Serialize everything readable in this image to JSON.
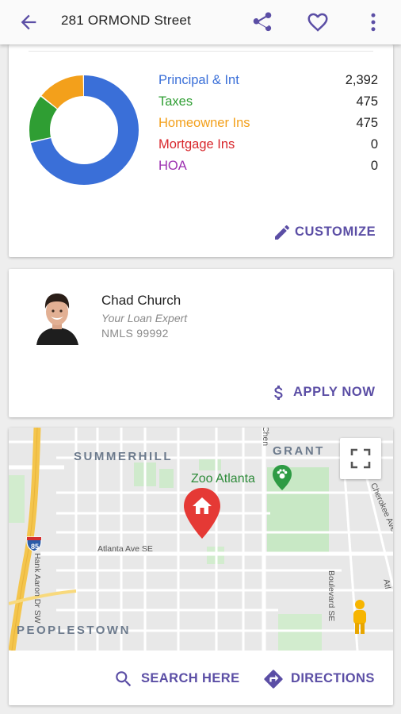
{
  "app_bar": {
    "title": "281 ORMOND Street",
    "icons": [
      "arrow-back-icon",
      "share-icon",
      "heart-outline-icon",
      "more-vert-icon"
    ]
  },
  "payment_breakdown": {
    "items": [
      {
        "label": "Principal & Int",
        "value": "2,392",
        "color": "#3a6fd8"
      },
      {
        "label": "Taxes",
        "value": "475",
        "color": "#2f9e33"
      },
      {
        "label": "Homeowner Ins",
        "value": "475",
        "color": "#f3a01b"
      },
      {
        "label": "Mortgage Ins",
        "value": "0",
        "color": "#d8262b"
      },
      {
        "label": "HOA",
        "value": "0",
        "color": "#9c2fb0"
      }
    ],
    "customize_label": "CUSTOMIZE"
  },
  "loan_expert": {
    "name": "Chad Church",
    "role": "Your Loan Expert",
    "nmls": "NMLS 99992",
    "apply_label": "APPLY NOW"
  },
  "map": {
    "areas": [
      "SUMMERHILL",
      "GRANT",
      "PEOPLESTOWN"
    ],
    "poi": "Zoo Atlanta",
    "streets": [
      "Atlanta Ave SE",
      "Hank Aaron Dr SW",
      "Boulevard SE",
      "Chen",
      "Cherokee Ave SE",
      "Atl"
    ],
    "highway_shield": "85",
    "search_label": "SEARCH HERE",
    "directions_label": "DIRECTIONS"
  },
  "colors": {
    "accent": "#5b4ea5",
    "pin": "#e53935"
  }
}
